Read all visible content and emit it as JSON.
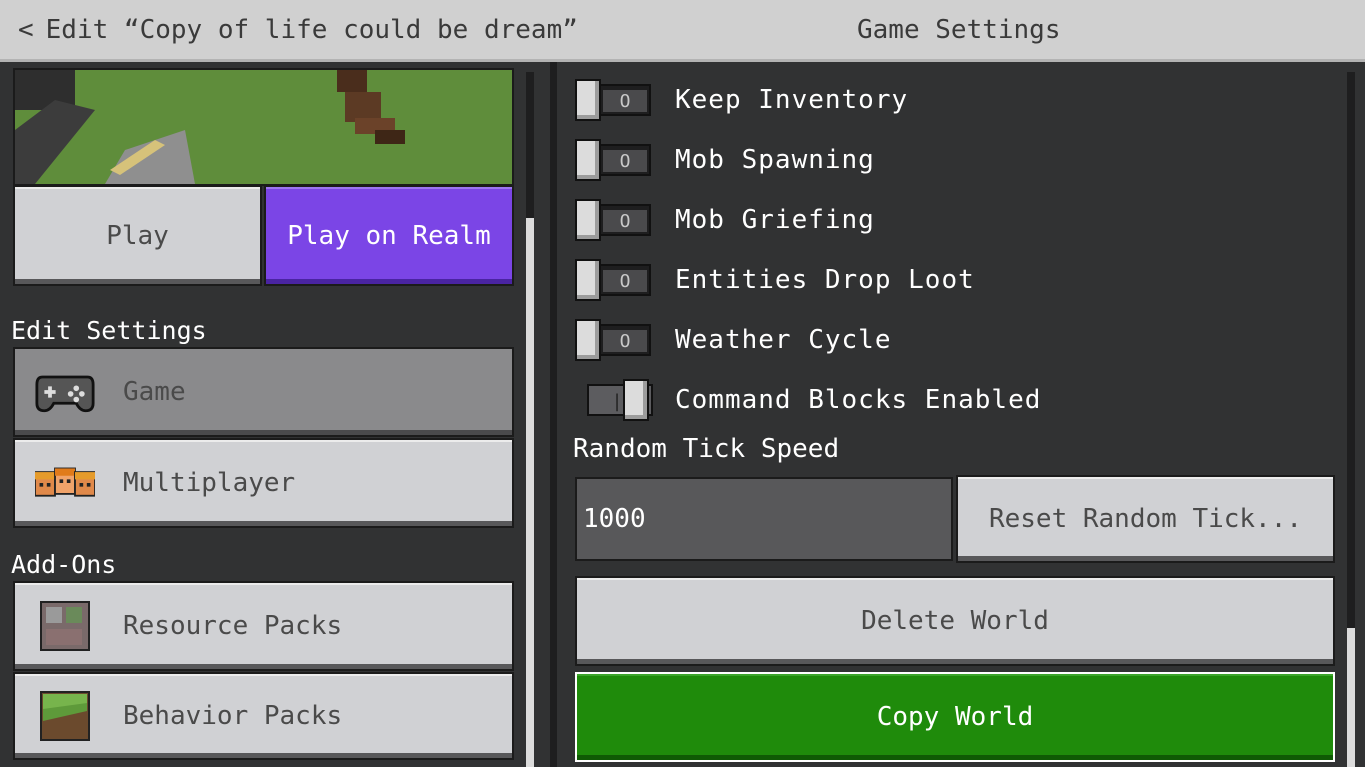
{
  "header": {
    "back_label": "Edit “Copy of life could be dream”",
    "page_title": "Game Settings"
  },
  "left": {
    "play_label": "Play",
    "play_realm_label": "Play on Realm",
    "edit_settings_heading": "Edit Settings",
    "nav_items": [
      {
        "label": "Game",
        "icon": "gamepad-icon",
        "selected": true
      },
      {
        "label": "Multiplayer",
        "icon": "players-icon",
        "selected": false
      }
    ],
    "addons_heading": "Add-Ons",
    "addon_items": [
      {
        "label": "Resource Packs",
        "icon": "resource-pack-icon"
      },
      {
        "label": "Behavior Packs",
        "icon": "behavior-pack-icon"
      }
    ]
  },
  "settings": {
    "toggles": [
      {
        "label": "Keep Inventory",
        "state": "off"
      },
      {
        "label": "Mob Spawning",
        "state": "off"
      },
      {
        "label": "Mob Griefing",
        "state": "off"
      },
      {
        "label": "Entities Drop Loot",
        "state": "off"
      },
      {
        "label": "Weather Cycle",
        "state": "off"
      },
      {
        "label": "Command Blocks Enabled",
        "state": "on"
      }
    ],
    "random_tick_label": "Random Tick Speed",
    "random_tick_value": "1000",
    "reset_tick_label": "Reset Random Tick...",
    "delete_world_label": "Delete World",
    "copy_world_label": "Copy World"
  },
  "colors": {
    "realm_purple": "#7b45e6",
    "copy_green": "#1f8b0b",
    "panel_bg": "#313233"
  }
}
